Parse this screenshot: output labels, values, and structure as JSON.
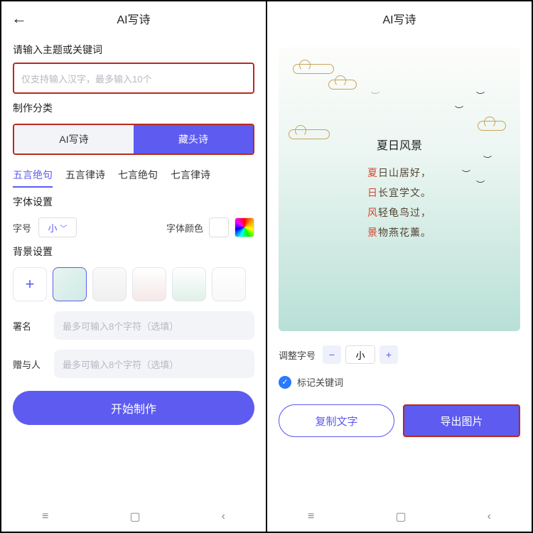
{
  "left": {
    "title": "AI写诗",
    "section1": "请输入主题或关键词",
    "input_ph": "仅支持输入汉字，最多输入10个",
    "section2": "制作分类",
    "tabs": [
      "AI写诗",
      "藏头诗"
    ],
    "subtabs": [
      "五言绝句",
      "五言律诗",
      "七言绝句",
      "七言律诗"
    ],
    "font_section": "字体设置",
    "font_size_label": "字号",
    "font_size_value": "小",
    "font_color_label": "字体颜色",
    "bg_section": "背景设置",
    "sign_label": "署名",
    "sign_ph": "最多可输入8个字符（选填）",
    "to_label": "赠与人",
    "to_ph": "最多可输入8个字符（选填）",
    "start": "开始制作"
  },
  "right": {
    "title": "AI写诗",
    "poem_title": "夏日风景",
    "lines": [
      {
        "hl": "夏",
        "rest": "日山居好，"
      },
      {
        "hl": "日",
        "rest": "长宜学文。"
      },
      {
        "hl": "风",
        "rest": "轻龟鸟过，"
      },
      {
        "hl": "景",
        "rest": "物燕花薰。"
      }
    ],
    "adjust_label": "调整字号",
    "adjust_value": "小",
    "mark_label": "标记关键词",
    "copy": "复制文字",
    "export": "导出图片"
  }
}
